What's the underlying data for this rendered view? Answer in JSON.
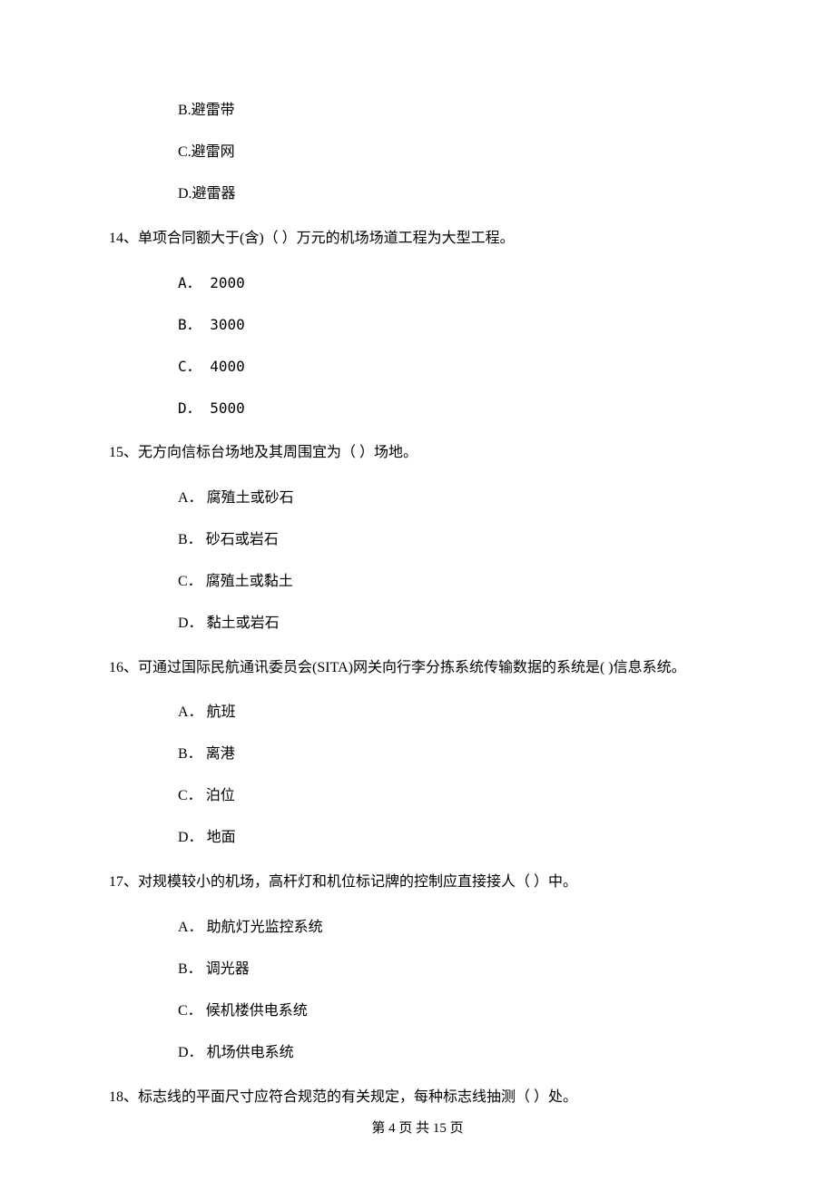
{
  "orphan_options": [
    {
      "label": "B.避雷带"
    },
    {
      "label": "C.避雷网"
    },
    {
      "label": "D.避雷器"
    }
  ],
  "questions": [
    {
      "num": "14、",
      "text": "单项合同额大于(含)（    ）万元的机场场道工程为大型工程。",
      "options": [
        {
          "letter": "A．",
          "text": "2000"
        },
        {
          "letter": "B．",
          "text": "3000"
        },
        {
          "letter": "C．",
          "text": "4000"
        },
        {
          "letter": "D．",
          "text": "5000"
        }
      ]
    },
    {
      "num": "15、",
      "text": "无方向信标台场地及其周围宜为（    ）场地。",
      "options": [
        {
          "letter": "A．",
          "text": "腐殖土或砂石"
        },
        {
          "letter": "B．",
          "text": "砂石或岩石"
        },
        {
          "letter": "C．",
          "text": "腐殖土或黏土"
        },
        {
          "letter": "D．",
          "text": "黏土或岩石"
        }
      ]
    },
    {
      "num": "16、",
      "text": "可通过国际民航通讯委员会(SITA)网关向行李分拣系统传输数据的系统是(     )信息系统。",
      "options": [
        {
          "letter": "A．",
          "text": "航班"
        },
        {
          "letter": "B．",
          "text": "离港"
        },
        {
          "letter": "C．",
          "text": "泊位"
        },
        {
          "letter": "D．",
          "text": "地面"
        }
      ]
    },
    {
      "num": "17、",
      "text": "对规模较小的机场，高杆灯和机位标记牌的控制应直接接人（    ）中。",
      "options": [
        {
          "letter": "A．",
          "text": "助航灯光监控系统"
        },
        {
          "letter": "B．",
          "text": "调光器"
        },
        {
          "letter": "C．",
          "text": "候机楼供电系统"
        },
        {
          "letter": "D．",
          "text": "机场供电系统"
        }
      ]
    },
    {
      "num": "18、",
      "text": "标志线的平面尺寸应符合规范的有关规定，每种标志线抽测（    ）处。",
      "options": []
    }
  ],
  "footer": "第 4 页 共 15 页"
}
